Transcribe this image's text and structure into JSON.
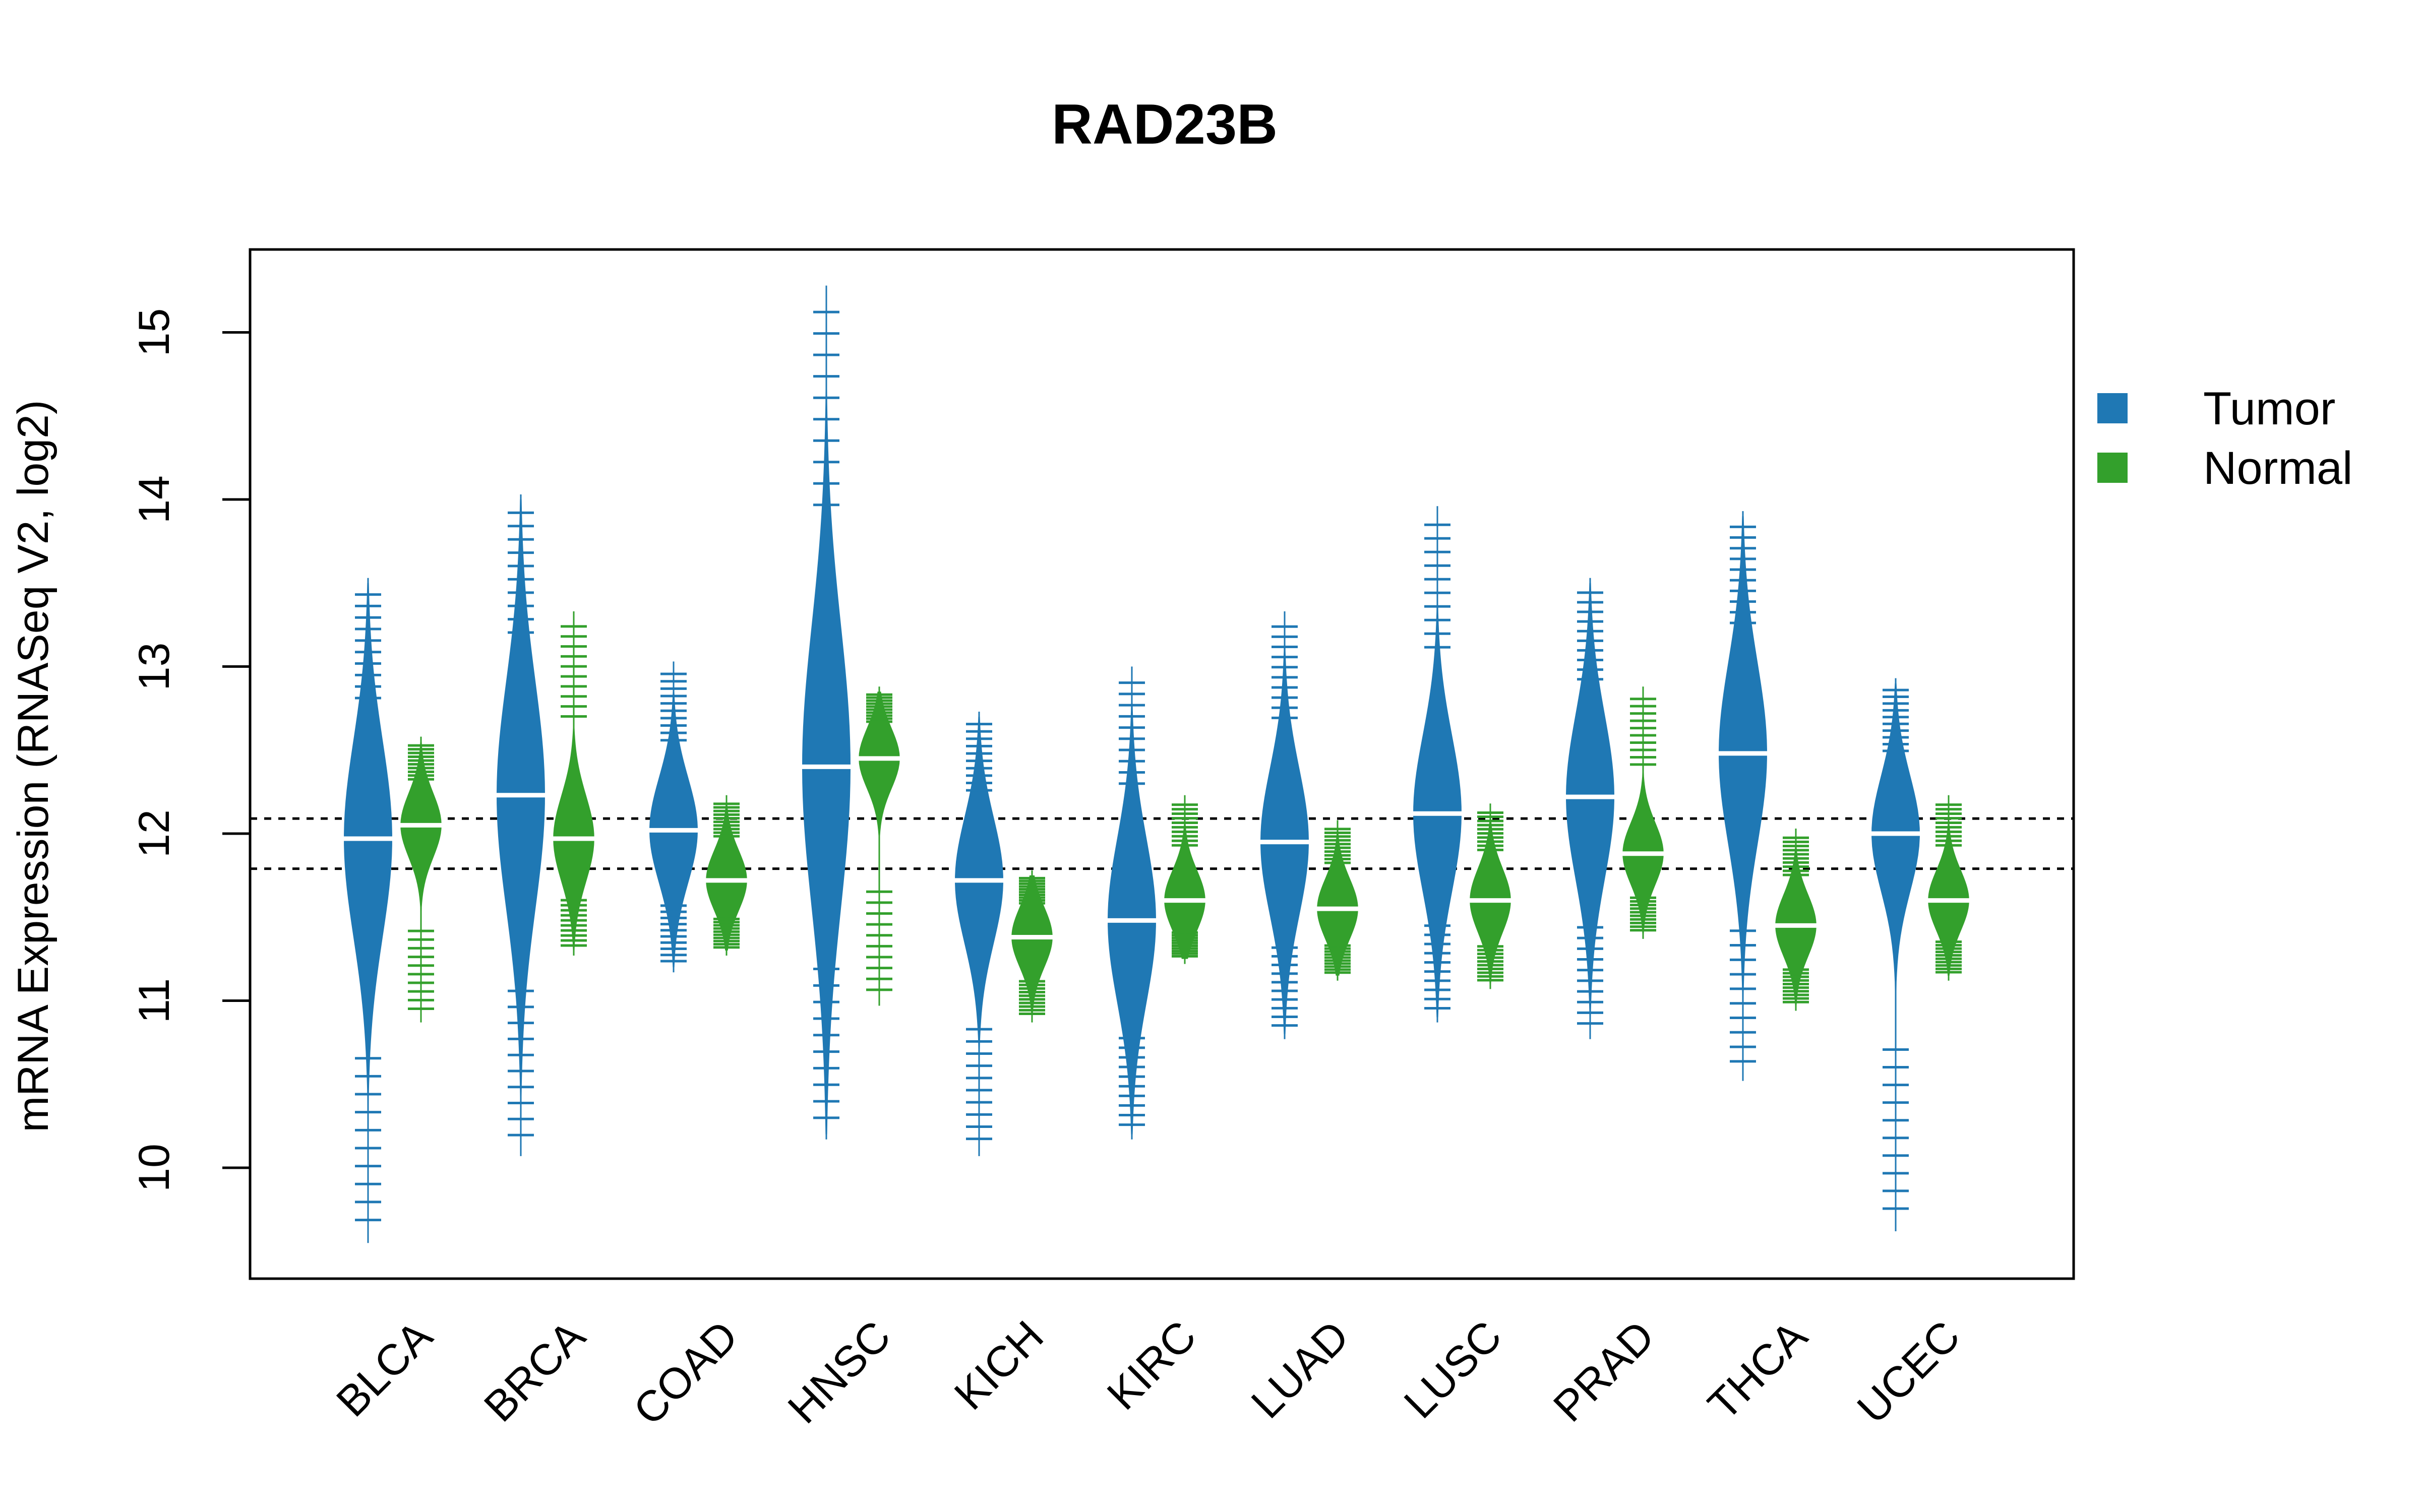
{
  "chart_data": {
    "type": "beanplot",
    "title": "RAD23B",
    "xlabel": "",
    "ylabel": "mRNA Expression (RNASeq V2, log2)",
    "ylim": [
      9.4,
      15.5
    ],
    "yticks": [
      "10",
      "11",
      "12",
      "13",
      "14",
      "15"
    ],
    "ytick_values": [
      10,
      11,
      12,
      13,
      14,
      15
    ],
    "grid": false,
    "reference_lines": [
      12.09,
      11.79
    ],
    "legend": {
      "position": "right",
      "entries": [
        {
          "label": "Tumor",
          "color": "#1f78b4"
        },
        {
          "label": "Normal",
          "color": "#33a02c"
        }
      ]
    },
    "categories": [
      "BLCA",
      "BRCA",
      "COAD",
      "HNSC",
      "KICH",
      "KIRC",
      "LUAD",
      "LUSC",
      "PRAD",
      "THCA",
      "UCEC"
    ],
    "series": [
      {
        "name": "Tumor",
        "color": "#1f78b4",
        "median": [
          11.97,
          12.23,
          12.02,
          12.4,
          11.72,
          11.48,
          11.95,
          12.12,
          12.22,
          12.48,
          12.0
        ],
        "min": [
          9.58,
          10.1,
          11.2,
          10.2,
          10.1,
          10.2,
          10.8,
          10.9,
          10.8,
          10.55,
          9.65
        ],
        "max": [
          13.5,
          14.0,
          13.0,
          15.25,
          12.7,
          12.97,
          13.3,
          13.93,
          13.5,
          13.9,
          12.9
        ]
      },
      {
        "name": "Normal",
        "color": "#33a02c",
        "median": [
          12.05,
          11.97,
          11.72,
          12.45,
          11.38,
          11.6,
          11.55,
          11.6,
          11.88,
          11.45,
          11.6
        ],
        "min": [
          10.9,
          11.3,
          11.3,
          11.0,
          10.9,
          11.25,
          11.15,
          11.1,
          11.4,
          10.97,
          11.15
        ],
        "max": [
          12.55,
          13.3,
          12.2,
          12.85,
          11.75,
          12.2,
          12.05,
          12.15,
          12.85,
          12.0,
          12.2
        ]
      }
    ]
  }
}
